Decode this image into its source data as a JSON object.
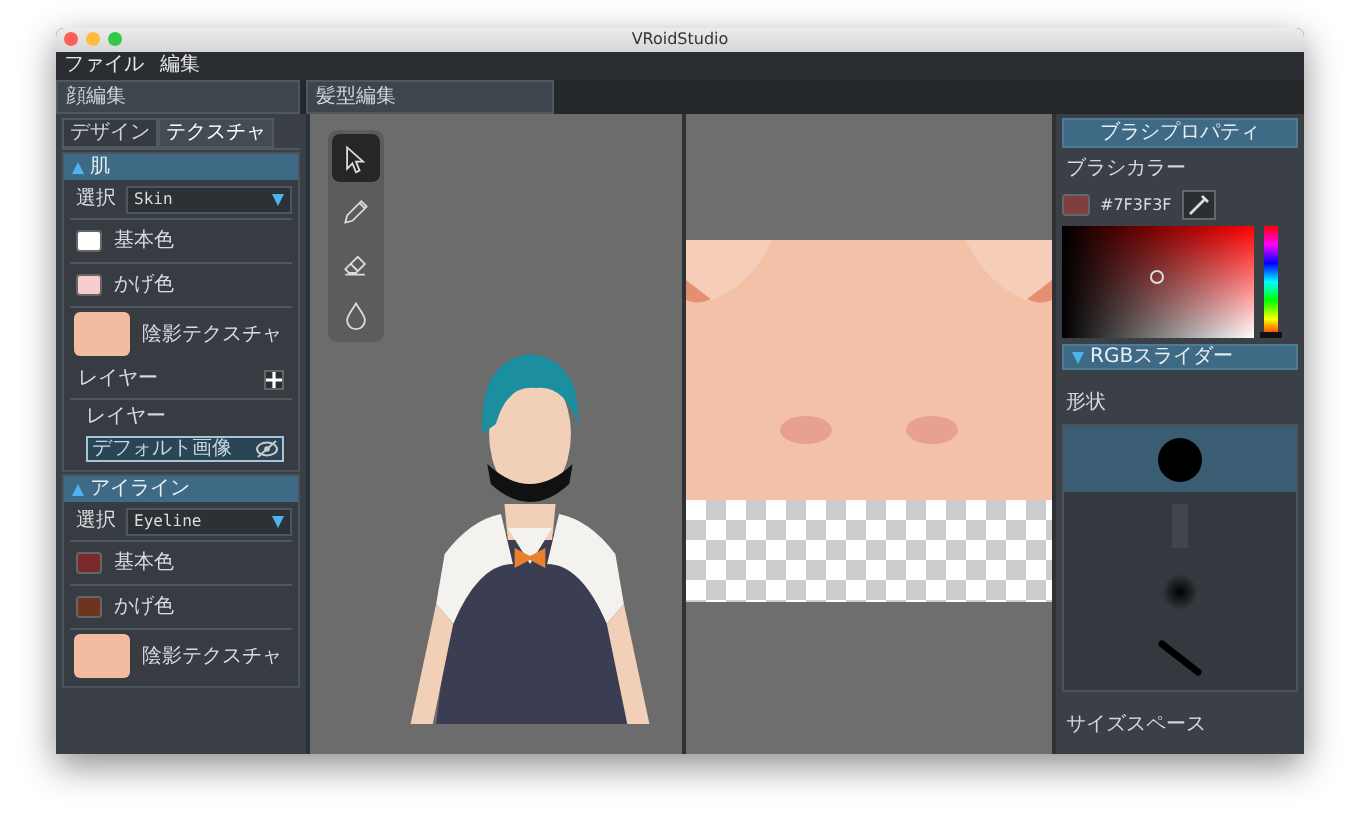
{
  "window": {
    "title": "VRoidStudio"
  },
  "menu": [
    "ファイル",
    "編集"
  ],
  "left_panel": {
    "title": "顔編集",
    "tabs": [
      {
        "label": "デザイン",
        "selected": false
      },
      {
        "label": "テクスチャ",
        "selected": true
      }
    ],
    "sections": [
      {
        "title": "肌",
        "expanded": true,
        "select_label": "選択",
        "select_value": "Skin",
        "colors": [
          {
            "label": "基本色",
            "color": "#ffffff"
          },
          {
            "label": "かげ色",
            "color": "#f8cccc"
          }
        ],
        "texture_label": "陰影テクスチャ",
        "layers": {
          "title": "レイヤー",
          "list_title": "レイヤー",
          "items": [
            {
              "name": "デフォルト画像",
              "selected": true,
              "visible": false
            }
          ]
        }
      },
      {
        "title": "アイライン",
        "expanded": true,
        "select_label": "選択",
        "select_value": "Eyeline",
        "colors": [
          {
            "label": "基本色",
            "color": "#7a2a2a"
          },
          {
            "label": "かげ色",
            "color": "#6e3420"
          }
        ],
        "texture_label": "陰影テクスチャ"
      }
    ]
  },
  "center_tab": {
    "label": "髪型編集"
  },
  "tools": [
    {
      "kind": "select",
      "selected": true
    },
    {
      "kind": "pencil",
      "selected": false
    },
    {
      "kind": "eraser",
      "selected": false
    },
    {
      "kind": "fill",
      "selected": false
    }
  ],
  "brush_panel": {
    "title": "ブラシプロパティ",
    "color_label": "ブラシカラー",
    "color": "#7f3f3f",
    "hex": "#7F3F3F",
    "hue_slider": {
      "level": 1
    },
    "rgb_slider": {
      "label": "RGBスライダー",
      "expanded": false
    },
    "shape_label": "形状",
    "shapes": [
      {
        "kind": "round",
        "selected": true
      },
      {
        "kind": "texture",
        "selected": false
      },
      {
        "kind": "soft",
        "selected": false
      },
      {
        "kind": "line",
        "selected": false
      }
    ],
    "size_label": "サイズスペース"
  }
}
